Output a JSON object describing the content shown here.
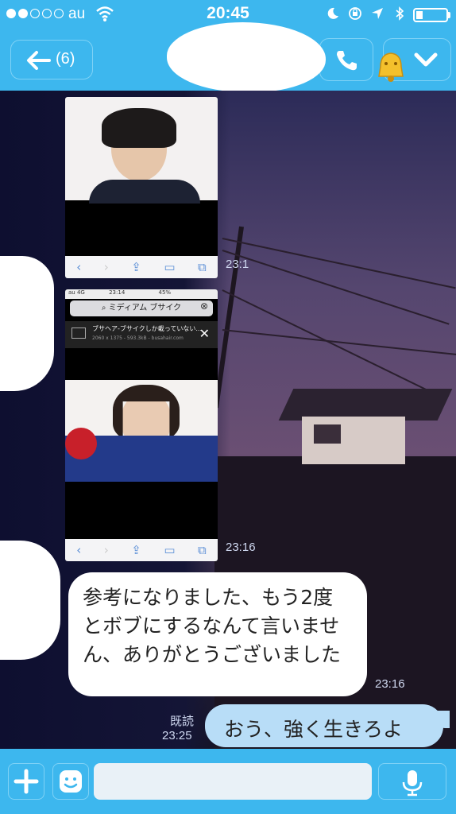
{
  "status_bar": {
    "carrier": "au",
    "time": "20:45",
    "battery_level": 0.2,
    "signal_bars": 2,
    "icons": [
      "moon-icon",
      "orientation-lock-icon",
      "location-icon",
      "bluetooth-icon"
    ]
  },
  "header": {
    "back_count": "(6)",
    "icons": [
      "back-arrow-icon",
      "phone-icon",
      "chevron-down-icon",
      "bell-icon"
    ]
  },
  "messages": [
    {
      "type": "image",
      "direction": "in",
      "time": "23:1"
    },
    {
      "type": "image",
      "direction": "in",
      "time": "23:16",
      "search_text": "ミディアム ブサイク",
      "card_title": "ブサヘア-ブサイクしか載っていない...",
      "card_sub": "2060 x 1375 - 593.3kB - busahair.com",
      "status_carrier": "au",
      "status_network": "4G",
      "status_time": "23:14",
      "status_battery": "45%"
    },
    {
      "type": "text",
      "direction": "in",
      "text": "参考になりました、もう2度とボブにするなんて言いません、ありがとうございました",
      "time": "23:16"
    },
    {
      "type": "text",
      "direction": "out",
      "text": "おう、強く生きろよ",
      "read_label": "既読",
      "time": "23:25"
    }
  ],
  "input_bar": {
    "placeholder": "",
    "icons": [
      "plus-icon",
      "sticker-icon",
      "mic-icon"
    ]
  },
  "colors": {
    "accent": "#3db7ee",
    "bubble_out": "#b8ddf7",
    "bubble_in": "#ffffff"
  }
}
